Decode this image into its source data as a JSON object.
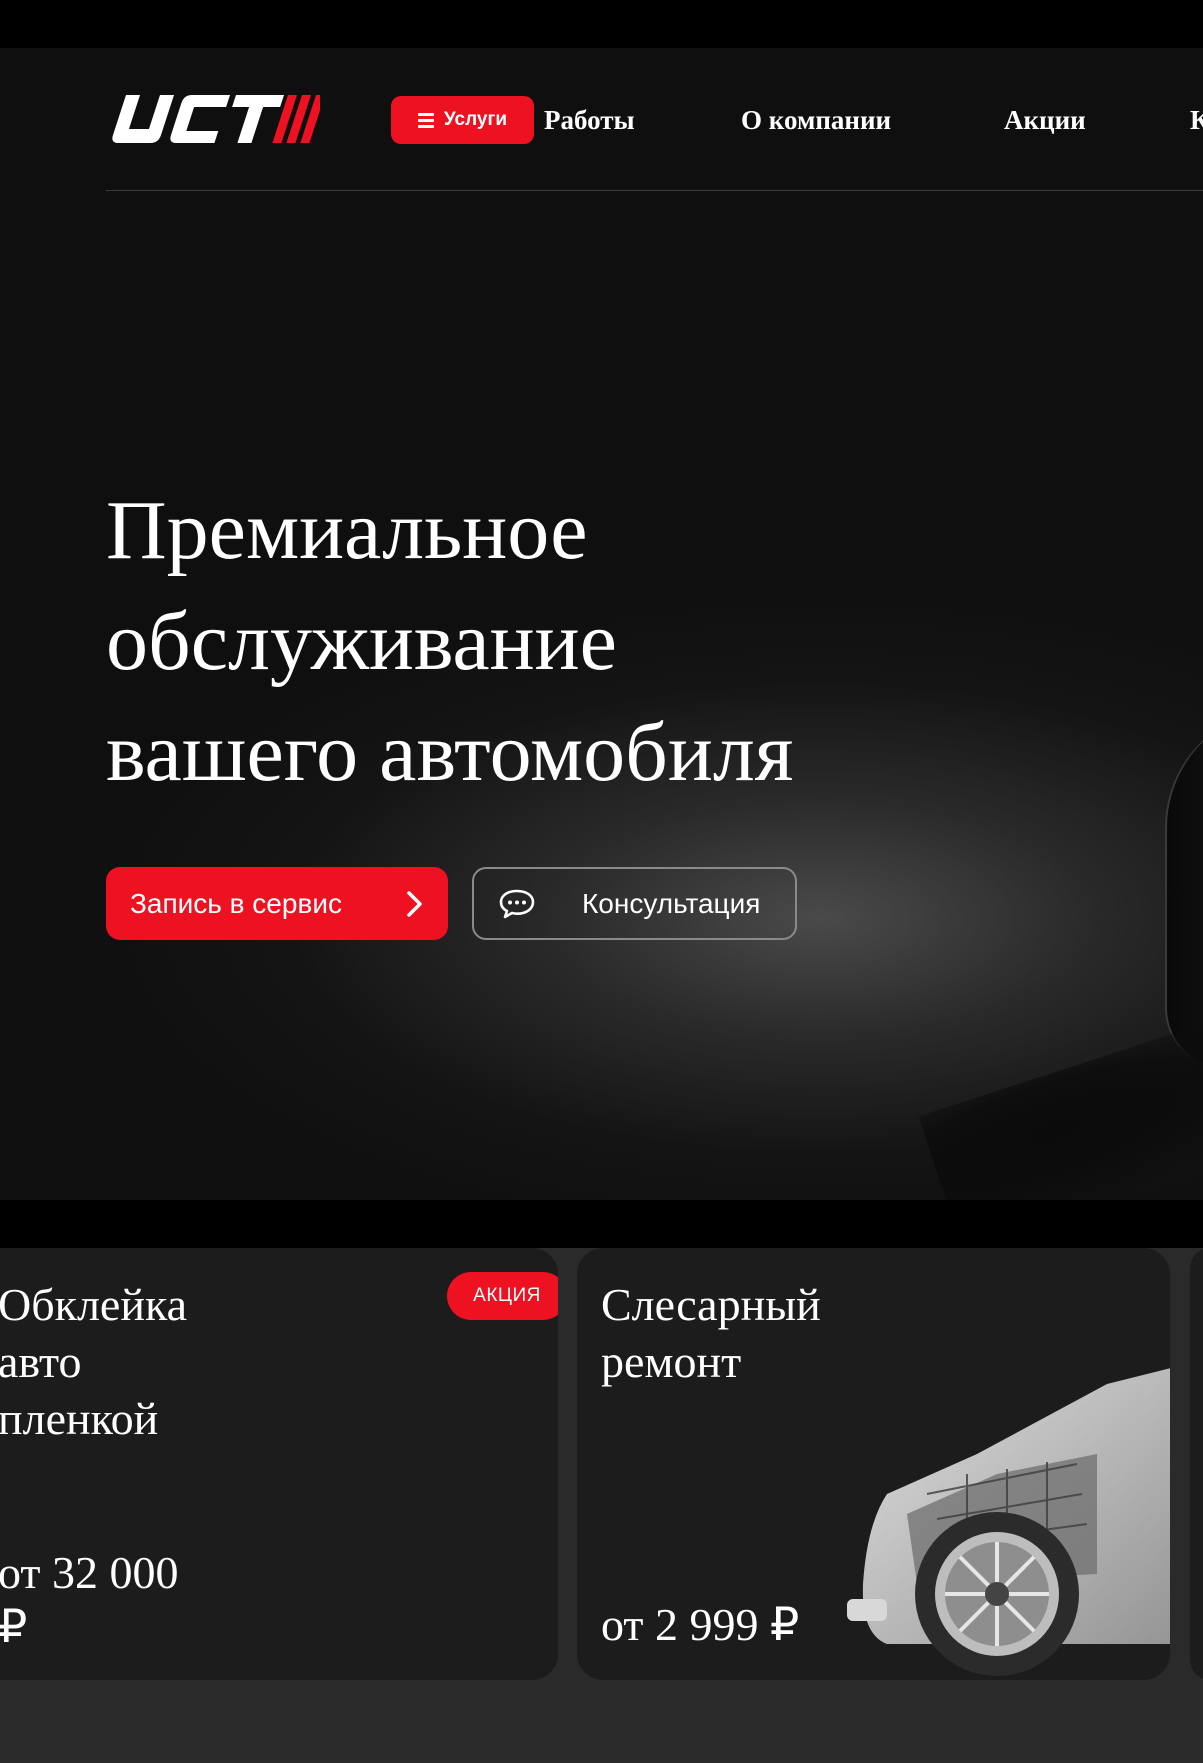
{
  "colors": {
    "accent": "#ee1122",
    "background": "#0f0f0f",
    "card": "#1c1c1c"
  },
  "header": {
    "logo_text": "UCT",
    "services_label": "Услуги",
    "nav": [
      {
        "label": "Работы"
      },
      {
        "label": "О компании"
      },
      {
        "label": "Акции"
      },
      {
        "label": "К"
      }
    ]
  },
  "hero": {
    "title_lines": [
      "Премиальное",
      "обслуживание",
      "вашего автомобиля"
    ],
    "primary_button": "Запись в сервис",
    "secondary_button": "Консультация"
  },
  "cards": [
    {
      "title_lines": [
        "Обклейка",
        "авто",
        "пленкой"
      ],
      "price_lines": [
        "от 32 000",
        "₽"
      ],
      "badge": "АКЦИЯ"
    },
    {
      "title_lines": [
        "Слесарный",
        "ремонт"
      ],
      "price": "от 2 999 ₽"
    }
  ]
}
